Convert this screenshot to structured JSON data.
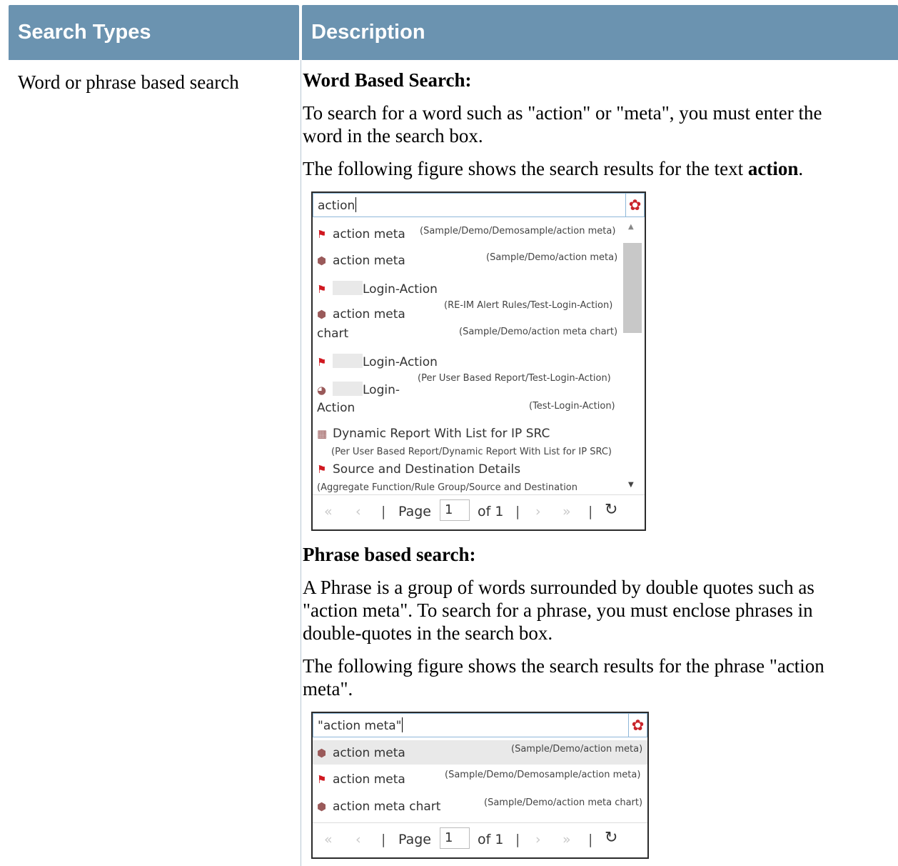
{
  "table": {
    "col1_header": "Search Types",
    "col2_header": "Description",
    "row1_type": "Word or phrase based search"
  },
  "word": {
    "heading": "Word Based Search:",
    "para1_line1": "To search for a word such as \"action\" or \"meta\", you must enter the",
    "para1_line2": "word in the search box.",
    "para2_prefix": "The following figure shows the search results for the text ",
    "para2_bold": "action",
    "para2_suffix": "."
  },
  "widget1": {
    "query": "action",
    "results": [
      {
        "icon": "flag-icon",
        "name": "action meta",
        "path": "(Sample/Demo/Demosample/action meta)"
      },
      {
        "icon": "cube-icon",
        "name": "action meta",
        "path": "(Sample/Demo/action meta)"
      },
      {
        "icon": "flag-icon",
        "name": "Login-Action",
        "path": "(RE-IM Alert Rules/Test-Login-Action)"
      },
      {
        "icon": "cube-icon",
        "name": "action meta",
        "name2": "chart",
        "path": "(Sample/Demo/action meta chart)"
      },
      {
        "icon": "flag-icon",
        "name": "Login-Action",
        "path": "(Per User Based Report/Test-Login-Action)"
      },
      {
        "icon": "report-icon",
        "name": "Login-",
        "name2": "Action",
        "path": "(Test-Login-Action)"
      },
      {
        "icon": "chart-icon",
        "name": "Dynamic Report With List for IP SRC",
        "path": "(Per User Based Report/Dynamic Report With List for IP SRC)"
      },
      {
        "icon": "flag-icon",
        "name": "Source and Destination Details",
        "path": "(Aggregate Function/Rule Group/Source and Destination"
      }
    ],
    "pager": {
      "page_label": "Page",
      "page_value": "1",
      "of_label": "of 1"
    }
  },
  "phrase": {
    "heading": "Phrase based search:",
    "para1_line1": "A Phrase is a group of words surrounded by double quotes such as",
    "para1_line2": "\"action meta\". To search for a phrase, you must enclose phrases in",
    "para1_line3": "double-quotes in the search box.",
    "para2_line1": "The following figure shows the search results for the phrase \"action",
    "para2_line2": "meta\"."
  },
  "widget2": {
    "query": "\"action meta\"",
    "results": [
      {
        "icon": "cube-icon",
        "name": "action meta",
        "path": "(Sample/Demo/action meta)"
      },
      {
        "icon": "flag-icon",
        "name": "action meta",
        "path": "(Sample/Demo/Demosample/action meta)"
      },
      {
        "icon": "cube-icon",
        "name": "action meta chart",
        "path": "(Sample/Demo/action meta chart)"
      }
    ],
    "pager": {
      "page_label": "Page",
      "page_value": "1",
      "of_label": "of 1"
    }
  },
  "colors": {
    "header_bg": "#6b93b0",
    "gear": "#c9242b",
    "flag": "#d01820"
  }
}
